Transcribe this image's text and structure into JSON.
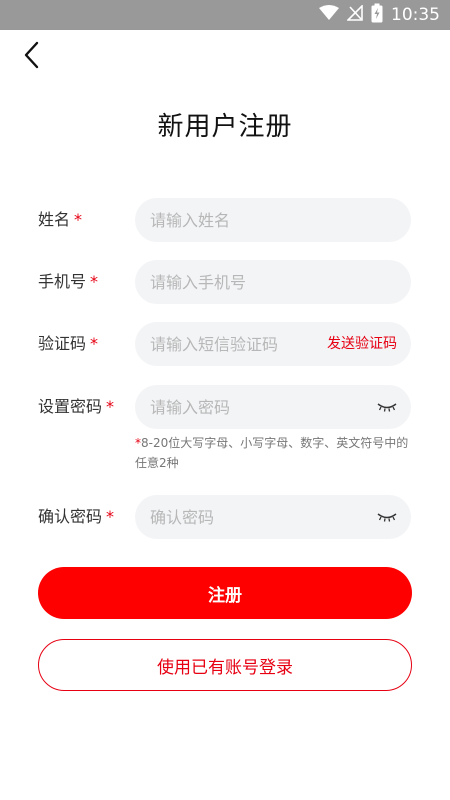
{
  "status_bar": {
    "time": "10:35"
  },
  "title": "新用户注册",
  "required_mark": "*",
  "fields": {
    "name": {
      "label": "姓名",
      "placeholder": "请输入姓名"
    },
    "phone": {
      "label": "手机号",
      "placeholder": "请输入手机号"
    },
    "code": {
      "label": "验证码",
      "placeholder": "请输入短信验证码",
      "send_label": "发送验证码"
    },
    "password": {
      "label": "设置密码",
      "placeholder": "请输入密码"
    },
    "confirm": {
      "label": "确认密码",
      "placeholder": "确认密码"
    }
  },
  "password_hint": "8-20位大写字母、小写字母、数字、英文符号中的任意2种",
  "register_label": "注册",
  "login_label": "使用已有账号登录",
  "colors": {
    "accent": "#e60012",
    "button": "#ff0000",
    "field_bg": "#f3f4f6",
    "status_bar": "#999999"
  }
}
